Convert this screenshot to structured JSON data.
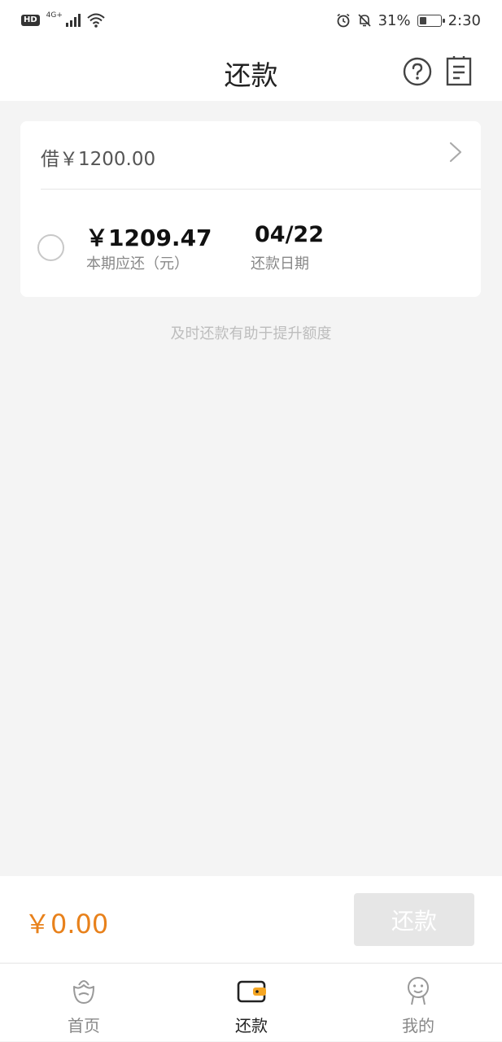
{
  "status_bar": {
    "hd": "HD",
    "network": "4G+",
    "battery": "31%",
    "time": "2:30",
    "icons": [
      "signal-icon",
      "wifi-icon",
      "alarm-icon",
      "bell-off-icon",
      "battery-icon"
    ]
  },
  "header": {
    "title": "还款",
    "icons": [
      "help-icon",
      "notes-icon"
    ]
  },
  "loan": {
    "summary": "借￥1200.00",
    "installment_amount": "￥1209.47",
    "installment_label": "本期应还（元）",
    "due_date": "04/22",
    "due_date_label": "还款日期",
    "selected": false
  },
  "hint": "及时还款有助于提升额度",
  "pay_bar": {
    "total": "￥0.00",
    "button_label": "还款"
  },
  "tabs": [
    {
      "label": "首页",
      "icon": "home-icon",
      "active": false
    },
    {
      "label": "还款",
      "icon": "wallet-icon",
      "active": true
    },
    {
      "label": "我的",
      "icon": "profile-icon",
      "active": false
    }
  ],
  "colors": {
    "accent": "#e8811b",
    "active_tab_icon": "#f5a623",
    "background": "#f4f4f4",
    "disabled_button": "#e6e6e6"
  }
}
